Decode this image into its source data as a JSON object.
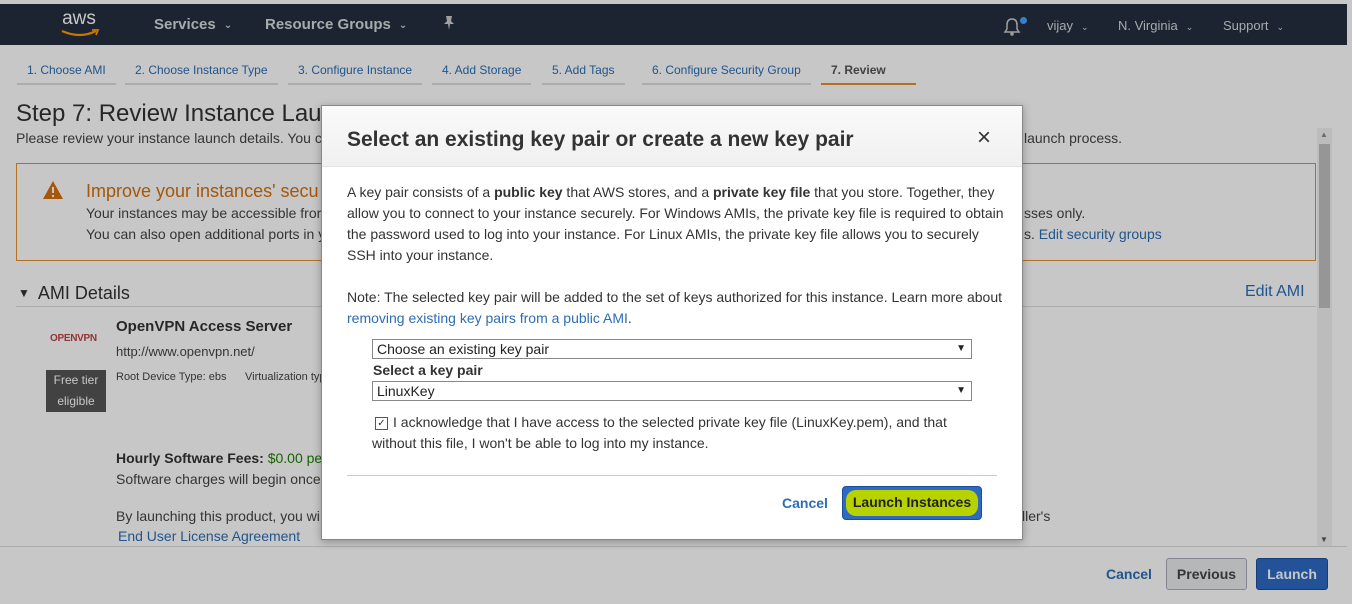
{
  "topbar": {
    "logo": "aws",
    "services": "Services",
    "resource_groups": "Resource Groups",
    "user": "vijay",
    "region": "N. Virginia",
    "support": "Support"
  },
  "steps": [
    {
      "label": "1. Choose AMI"
    },
    {
      "label": "2. Choose Instance Type"
    },
    {
      "label": "3. Configure Instance"
    },
    {
      "label": "4. Add Storage"
    },
    {
      "label": "5. Add Tags"
    },
    {
      "label": "6. Configure Security Group"
    },
    {
      "label": "7. Review"
    }
  ],
  "page": {
    "title": "Step 7: Review Instance Lau",
    "subtitle_left": "Please review your instance launch details. You c",
    "subtitle_right": "launch process."
  },
  "warning": {
    "title": "Improve your instances' secu",
    "line1": "Your instances may be accessible fror",
    "line2": "You can also open additional ports in y",
    "line1_right": "sses only.",
    "line2_right_prefix": "s.",
    "edit_link": "Edit security groups"
  },
  "ami": {
    "section": "AMI Details",
    "edit": "Edit AMI",
    "logo_text": "OPENVPN",
    "free_tier": [
      "Free tier",
      "eligible"
    ],
    "name": "OpenVPN Access Server",
    "url": "http://www.openvpn.net/",
    "root_device": "Root Device Type: ebs",
    "virtualization": "Virtualization typ",
    "fees_label": "Hourly Software Fees:",
    "fees_value": "$0.00 pe",
    "charges": "Software charges will begin once",
    "launching": "By launching this product, you wi",
    "launching_right": "ller's",
    "eula": "End User License Agreement"
  },
  "footer": {
    "cancel": "Cancel",
    "previous": "Previous",
    "launch": "Launch"
  },
  "modal": {
    "title": "Select an existing key pair or create a new key pair",
    "close": "×",
    "p1_a": "A key pair consists of a ",
    "p1_b": "public key",
    "p1_c": " that AWS stores, and a ",
    "p1_d": "private key file",
    "p1_e": " that you store. Together, they allow you to connect to your instance securely. For Windows AMIs, the private key file is required to obtain the password used to log into your instance. For Linux AMIs, the private key file allows you to securely SSH into your instance.",
    "note_a": "Note: The selected key pair will be added to the set of keys authorized for this instance. Learn more about ",
    "note_link": "removing existing key pairs from a public AMI",
    "note_b": ".",
    "select_mode": "Choose an existing key pair",
    "select_label": "Select a key pair",
    "select_key": "LinuxKey",
    "ack": "I acknowledge that I have access to the selected private key file (LinuxKey.pem), and that without this file, I won't be able to log into my instance.",
    "cancel": "Cancel",
    "launch": "Launch Instances"
  },
  "colors": {
    "topbar": "#232f3e",
    "accent_orange": "#e88f2b",
    "link_blue": "#2c6db5",
    "primary_button": "#2d6ac4",
    "highlight": "#b8d200"
  }
}
